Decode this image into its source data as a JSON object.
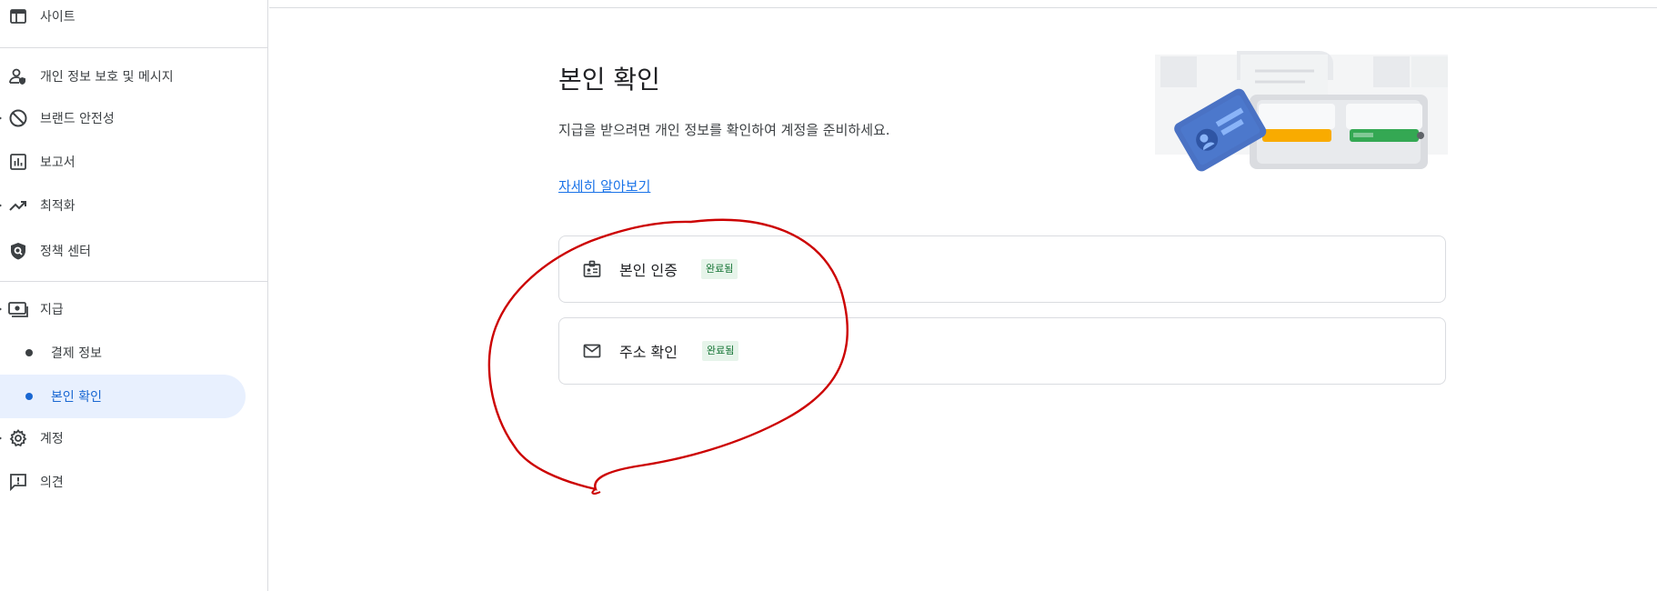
{
  "sidebar": {
    "items": [
      {
        "label": "사이트",
        "icon": "web-icon"
      },
      {
        "label": "개인 정보 보호 및 메시지",
        "icon": "privacy-person-icon"
      },
      {
        "label": "브랜드 안전성",
        "icon": "block-icon"
      },
      {
        "label": "보고서",
        "icon": "bar-chart-icon"
      },
      {
        "label": "최적화",
        "icon": "trending-up-icon"
      },
      {
        "label": "정책 센터",
        "icon": "policy-shield-icon"
      },
      {
        "label": "지급",
        "icon": "payments-icon"
      },
      {
        "label": "계정",
        "icon": "gear-icon"
      },
      {
        "label": "의견",
        "icon": "feedback-icon"
      }
    ],
    "payments_sub": [
      {
        "label": "결제 정보"
      },
      {
        "label": "본인 확인"
      }
    ]
  },
  "main": {
    "title": "본인 확인",
    "description": "지급을 받으려면 개인 정보를 확인하여 계정을 준비하세요.",
    "learn_more": "자세히 알아보기",
    "cards": [
      {
        "label": "본인 인증",
        "badge": "완료됨",
        "icon": "id-badge-icon"
      },
      {
        "label": "주소 확인",
        "badge": "완료됨",
        "icon": "mail-icon"
      }
    ]
  },
  "colors": {
    "accent": "#1a73e8",
    "active_bg": "#e8f0fe",
    "badge_bg": "#e6f4ea",
    "badge_text": "#137333",
    "annotation": "#cc0000"
  }
}
